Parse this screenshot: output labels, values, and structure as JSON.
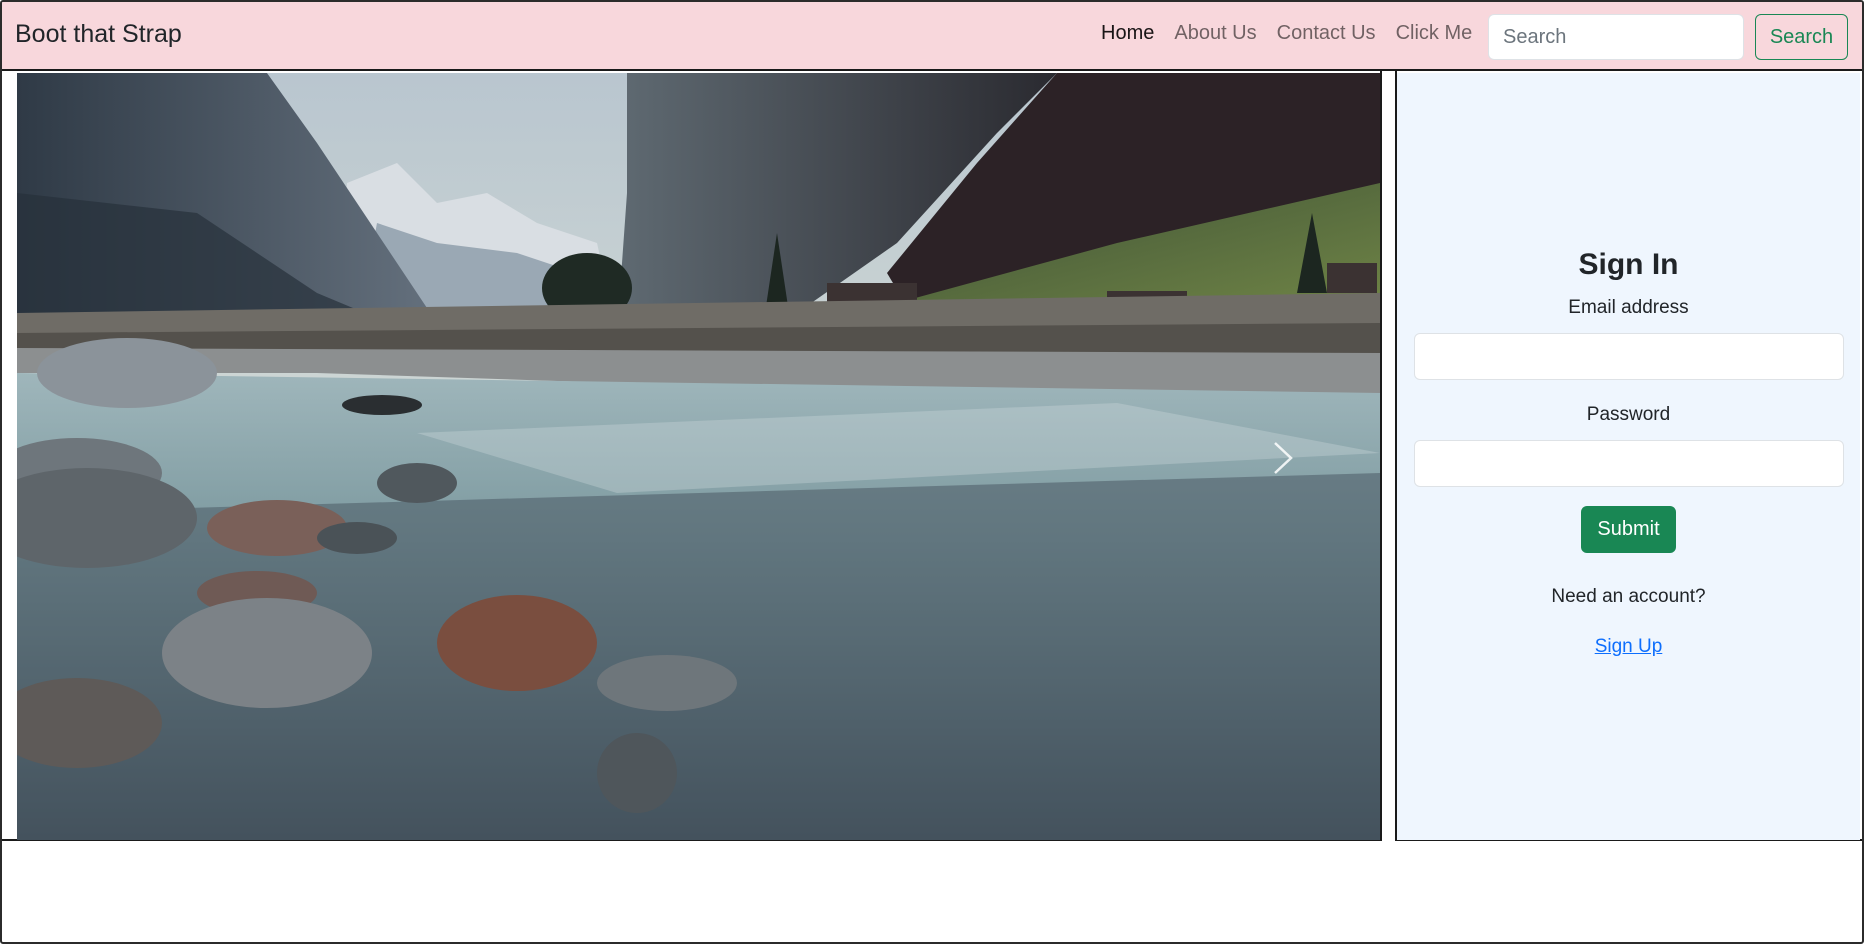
{
  "navbar": {
    "brand": "Boot that Strap",
    "links": [
      {
        "label": "Home",
        "active": true
      },
      {
        "label": "About Us",
        "active": false
      },
      {
        "label": "Contact Us",
        "active": false
      },
      {
        "label": "Click Me",
        "active": false
      }
    ],
    "search_placeholder": "Search",
    "search_button": "Search",
    "background_color": "#f8d7dc"
  },
  "carousel": {
    "image_description_icon": "landscape-river-image",
    "next_control_icon": "chevron-right-icon"
  },
  "signin": {
    "title": "Sign In",
    "email_label": "Email address",
    "email_value": "",
    "password_label": "Password",
    "password_value": "",
    "submit_label": "Submit",
    "need_account_text": "Need an account?",
    "signup_label": "Sign Up",
    "panel_color": "#eff6fe",
    "submit_color": "#198754",
    "link_color": "#0d6efd"
  }
}
